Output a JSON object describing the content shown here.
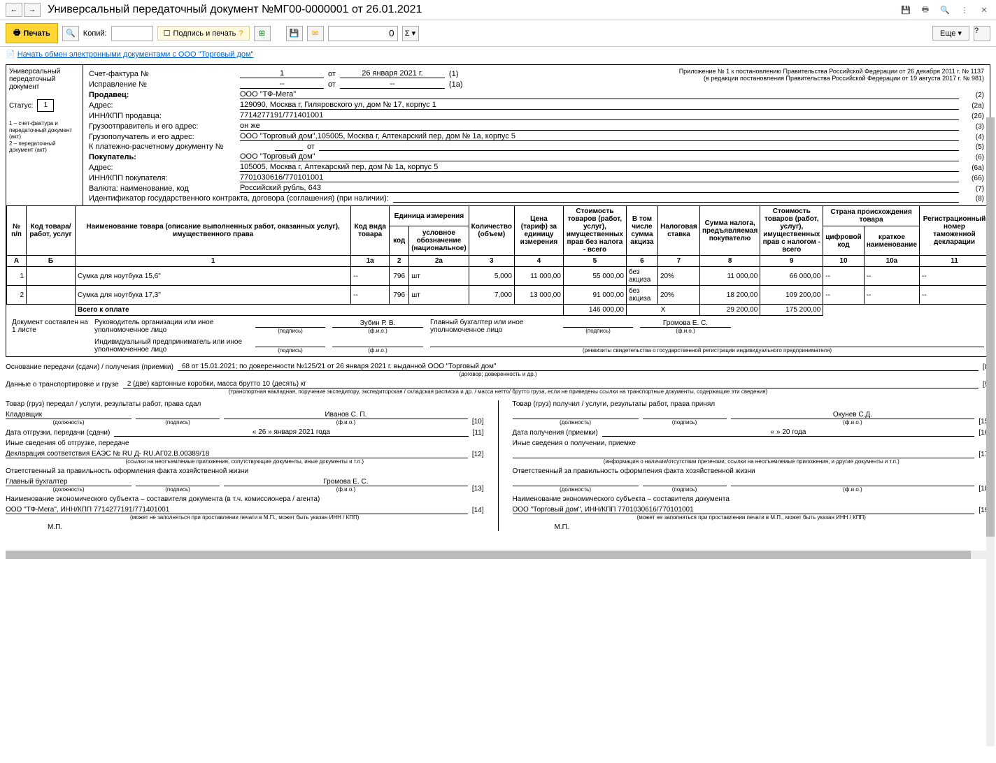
{
  "titlebar": {
    "title": "Универсальный передаточный документ №МГ00-0000001 от 26.01.2021"
  },
  "toolbar": {
    "print": "Печать",
    "copies_label": "Копий:",
    "sign": "Подпись и печать",
    "num_value": "0",
    "more": "Еще",
    "help": "?"
  },
  "link": "Начать обмен электронными документами с ООО \"Торговый дом\"",
  "leftcol": {
    "l1": "Универсальный",
    "l2": "передаточный",
    "l3": "документ",
    "status_label": "Статус:",
    "status_val": "1",
    "legend1": "1 – счет-фактура и передаточный документ (акт)",
    "legend2": "2 – передаточный документ (акт)"
  },
  "appendix": {
    "l1": "Приложение № 1 к постановлению Правительства Российской Федерации от 26 декабря 2011 г. № 1137",
    "l2": "(в редакции постановления Правительства Российской Федерации от 19 августа 2017 г. № 981)"
  },
  "header": {
    "sf_label": "Счет-фактура №",
    "sf_num": "1",
    "ot": "от",
    "sf_date": "26 января 2021 г.",
    "b1": "(1)",
    "isp_label": "Исправление №",
    "isp_num": "--",
    "isp_date": "--",
    "b1a": "(1а)",
    "seller_label": "Продавец:",
    "seller_val": "ООО \"ТФ-Мега\"",
    "b2": "(2)",
    "addr_label": "Адрес:",
    "addr_val": "129090, Москва г, Гиляровского ул, дом № 17, корпус 1",
    "b2a": "(2а)",
    "inn_s_label": "ИНН/КПП продавца:",
    "inn_s_val": "7714277191/771401001",
    "b2b": "(2б)",
    "shipper_label": "Грузоотправитель и его адрес:",
    "shipper_val": "он же",
    "b3": "(3)",
    "consignee_label": "Грузополучатель и его адрес:",
    "consignee_val": "ООО \"Торговый дом\",105005, Москва г, Аптекарский пер, дом № 1а, корпус 5",
    "b4": "(4)",
    "pay_label": "К платежно-расчетному документу №",
    "b5": "(5)",
    "buyer_label": "Покупатель:",
    "buyer_val": "ООО \"Торговый дом\"",
    "b6": "(6)",
    "buyer_addr_val": "105005, Москва г, Аптекарский пер, дом № 1а, корпус 5",
    "b6a": "(6а)",
    "inn_b_label": "ИНН/КПП покупателя:",
    "inn_b_val": "7701030616/770101001",
    "b6b": "(6б)",
    "currency_label": "Валюта: наименование, код",
    "currency_val": "Российский рубль, 643",
    "b7": "(7)",
    "contract_label": "Идентификатор государственного контракта, договора (соглашения) (при наличии):",
    "b8": "(8)"
  },
  "th": {
    "num": "№ п/п",
    "code": "Код товара/ работ, услуг",
    "name": "Наименование товара (описание выполненных работ, оказанных услуг), имущественного права",
    "kind": "Код вида товара",
    "unit": "Единица измерения",
    "unit_code": "код",
    "unit_name": "условное обозначение (национальное)",
    "qty": "Количество (объем)",
    "price": "Цена (тариф) за единицу измерения",
    "cost": "Стоимость товаров (работ, услуг), имущественных прав без налога - всего",
    "excise": "В том числе сумма акциза",
    "rate": "Налоговая ставка",
    "tax": "Сумма налога, предъявляемая покупателю",
    "total": "Стоимость товаров (работ, услуг), имущественных прав с налогом - всего",
    "origin": "Страна происхождения товара",
    "origin_code": "цифровой код",
    "origin_name": "краткое наименование",
    "decl": "Регистрационный номер таможенной декларации"
  },
  "cols": {
    "a": "А",
    "b": "Б",
    "c1": "1",
    "c1a": "1а",
    "c2": "2",
    "c2a": "2а",
    "c3": "3",
    "c4": "4",
    "c5": "5",
    "c6": "6",
    "c7": "7",
    "c8": "8",
    "c9": "9",
    "c10": "10",
    "c10a": "10а",
    "c11": "11"
  },
  "rows": [
    {
      "n": "1",
      "code": "",
      "name": "Сумка для ноутбука 15,6\"",
      "kind": "--",
      "ucode": "796",
      "uname": "шт",
      "qty": "5,000",
      "price": "11 000,00",
      "cost": "55 000,00",
      "excise": "без акциза",
      "rate": "20%",
      "tax": "11 000,00",
      "total": "66 000,00",
      "oc": "--",
      "on": "--",
      "decl": "--"
    },
    {
      "n": "2",
      "code": "",
      "name": "Сумка для ноутбука 17,3\"",
      "kind": "--",
      "ucode": "796",
      "uname": "шт",
      "qty": "7,000",
      "price": "13 000,00",
      "cost": "91 000,00",
      "excise": "без акциза",
      "rate": "20%",
      "tax": "18 200,00",
      "total": "109 200,00",
      "oc": "--",
      "on": "--",
      "decl": "--"
    }
  ],
  "totals": {
    "label": "Всего к оплате",
    "cost": "146 000,00",
    "x": "Х",
    "tax": "29 200,00",
    "total": "175 200,00"
  },
  "sign": {
    "doc_label": "Документ составлен на 1 листе",
    "head_label": "Руководитель организации или иное уполномоченное лицо",
    "head_name": "Зубин Р. В.",
    "acc_label": "Главный бухгалтер или иное уполномоченное лицо",
    "acc_name": "Громова Е. С.",
    "ip_label": "Индивидуальный предприниматель или иное уполномоченное лицо",
    "podpis": "(подпись)",
    "fio": "(ф.и.о.)",
    "rekv": "(реквизиты свидетельства о государственной регистрации индивидуального предпринимателя)"
  },
  "lower": {
    "base_label": "Основание передачи (сдачи) / получения (приемки)",
    "base_val": "68 от 15.01.2021; по доверенности №125/21 от 26 января 2021 г. выданной ООО \"Торговый дом\"",
    "base_sub": "(договор; доверенность и др.)",
    "b8": "[8]",
    "trans_label": "Данные о транспортировке и грузе",
    "trans_val": "2 (две) картонные коробки, масса брутто 10 (десять) кг",
    "trans_sub": "(транспортная накладная, поручение экспедитору, экспедиторская / складская расписка и др. / масса нетто/ брутто груза, если не приведены ссылки на транспортные документы, содержащие эти сведения)",
    "b9": "[9]"
  },
  "left": {
    "l1": "Товар (груз) передал / услуги, результаты работ, права сдал",
    "job": "Кладовщик",
    "name": "Иванов С. П.",
    "b10": "[10]",
    "job_sub": "(должность)",
    "sig_sub": "(подпись)",
    "fio_sub": "(ф.и.о.)",
    "date_label": "Дата отгрузки, передачи (сдачи)",
    "date_val": "« 26 »   января   2021   года",
    "b11": "[11]",
    "other_label": "Иные сведения об отгрузке, передаче",
    "other_val": "Декларация соответствия ЕАЭС № RU Д- RU.АГ02.В.00389/18",
    "b12": "[12]",
    "other_sub": "(ссылки на неотъемлемые приложения, сопутствующие документы, иные документы и т.п.)",
    "resp_label": "Ответственный за правильность оформления факта хозяйственной жизни",
    "resp_job": "Главный бухгалтер",
    "resp_name": "Громова Е. С.",
    "b13": "[13]",
    "subj_label": "Наименование экономического субъекта – составителя документа (в т.ч. комиссионера / агента)",
    "subj_val": "ООО \"ТФ-Мега\", ИНН/КПП 7714277191/771401001",
    "b14": "[14]",
    "subj_sub": "(может не заполняться при проставлении печати в М.П., может быть указан ИНН / КПП)",
    "mp": "М.П."
  },
  "right": {
    "l1": "Товар (груз) получил / услуги, результаты работ, права принял",
    "name": "Окунев С.Д.",
    "b15": "[15]",
    "date_label": "Дата получения (приемки)",
    "date_val": "«       »                    20       года",
    "b16": "[16]",
    "other_label": "Иные сведения о получении, приемке",
    "b17": "[17]",
    "other_sub": "(информация о наличии/отсутствии претензии; ссылки на неотъемлемые приложения, и другие документы и т.п.)",
    "resp_label": "Ответственный за правильность оформления факта хозяйственной жизни",
    "b18": "[18]",
    "subj_label": "Наименование экономического субъекта – составителя документа",
    "subj_val": "ООО \"Торговый дом\", ИНН/КПП 7701030616/770101001",
    "b19": "[19]",
    "subj_sub": "(может не заполняться при проставлении печати в М.П., может быть указан ИНН / КПП)",
    "mp": "М.П."
  }
}
